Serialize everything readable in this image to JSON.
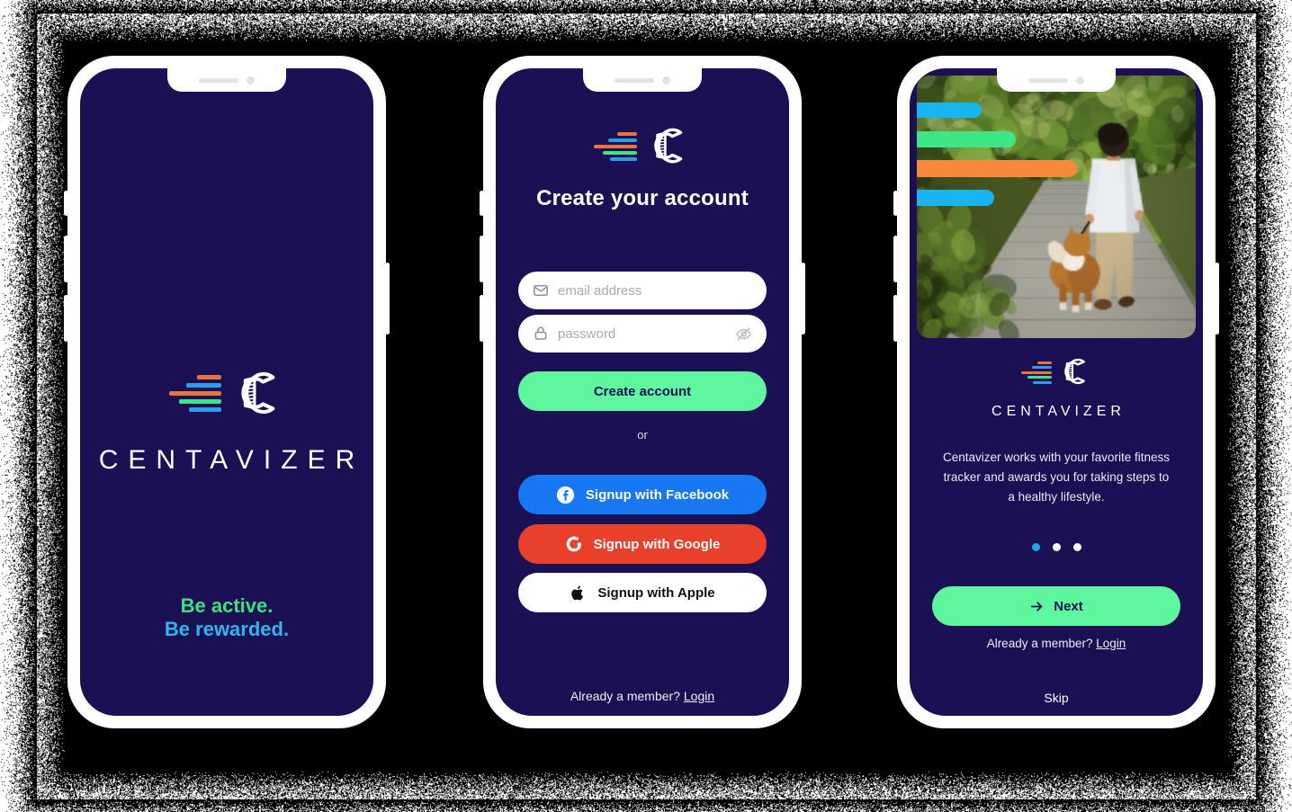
{
  "brand": {
    "wordmark": "CENTAVIZER",
    "logo_bar_colors": [
      "#e8743c",
      "#2f9ce8",
      "#e8743c",
      "#3ce585",
      "#2f9ce8"
    ],
    "accent_green": "#5ef79f",
    "accent_blue": "#18a8e8",
    "screen_bg": "#1b1054"
  },
  "screen_splash": {
    "tagline_line1": "Be active.",
    "tagline_line2": "Be rewarded.",
    "tagline_color1": "#3ee07f",
    "tagline_color2": "#2fb6ef"
  },
  "screen_signup": {
    "title": "Create your account",
    "email": {
      "placeholder": "email address",
      "value": ""
    },
    "password": {
      "placeholder": "password",
      "value": ""
    },
    "create_button": "Create account",
    "divider": "or",
    "facebook_button": "Signup with Facebook",
    "google_button": "Signup with Google",
    "apple_button": "Signup with Apple",
    "member_prefix": "Already a member?",
    "member_link": "Login",
    "colors": {
      "facebook": "#1877f2",
      "google": "#e8402a",
      "apple": "#ffffff"
    }
  },
  "screen_onboarding": {
    "hero_alt": "man walking a dog on a tree-lined sidewalk",
    "hero_bar_colors": [
      "#19b5f0",
      "#3ce585",
      "#f7893c",
      "#19b5f0"
    ],
    "wordmark": "CENTAVIZER",
    "description": "Centavizer works with your favorite fitness tracker and awards you for taking steps to a healthy lifestyle.",
    "dots": {
      "count": 3,
      "active_index": 0
    },
    "next_button": "Next",
    "next_icon": "arrow-right-icon",
    "member_prefix": "Already a member?",
    "member_link": "Login",
    "skip_button": "Skip"
  }
}
